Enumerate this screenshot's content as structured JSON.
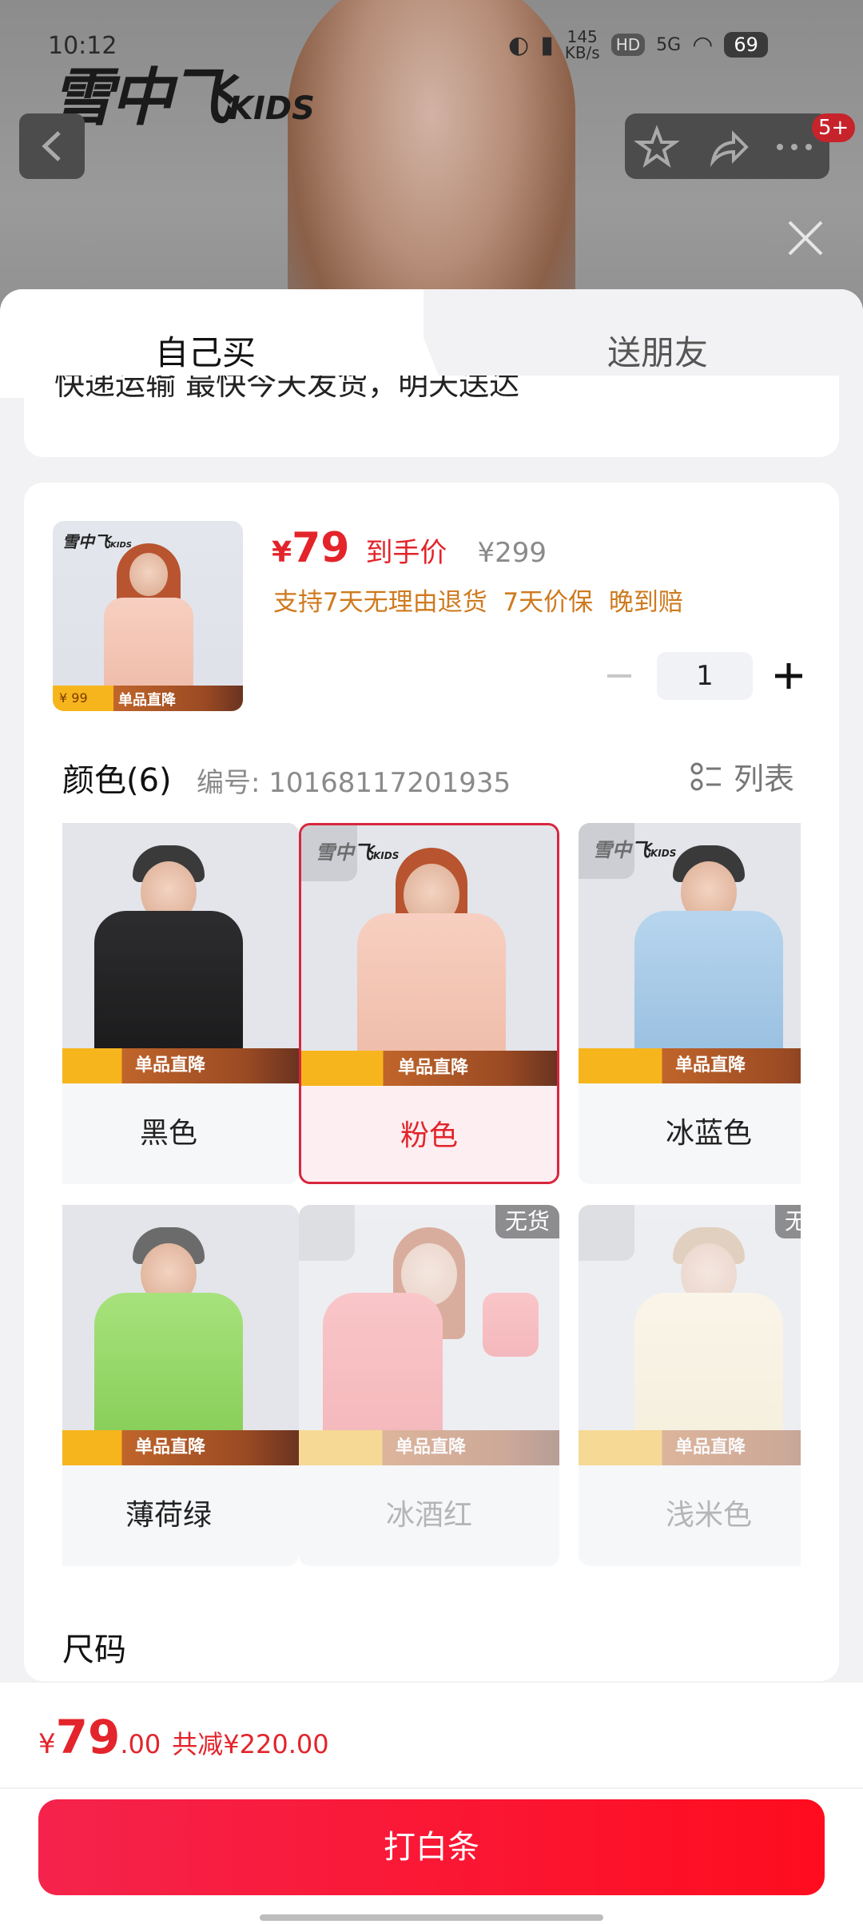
{
  "status_bar": {
    "time": "10:12",
    "net_speed": "145",
    "net_unit": "KB/s",
    "hd": "HD",
    "signal": "5G",
    "battery": "69"
  },
  "hero": {
    "brand": "雪中飞",
    "brand_suffix": "KIDS",
    "badge": "5+"
  },
  "tabs": {
    "self": "自己买",
    "friend": "送朋友"
  },
  "info_card": {
    "text": "快递运输 最快今天发货，明天送达"
  },
  "product": {
    "price_symbol": "¥",
    "price": "79",
    "price_label": "到手价",
    "original_price": "¥299",
    "services": "支持7天无理由退货  7天价保  晚到赔",
    "quantity": "1",
    "thumb_strip_price": "¥ 99",
    "thumb_strip_label": "单品直降"
  },
  "color_section": {
    "title": "颜色(6)",
    "code_label": "编号: 10168117201935",
    "list_label": "列表",
    "options": [
      {
        "label": "黑色",
        "selected": false,
        "soldout": false
      },
      {
        "label": "粉色",
        "selected": true,
        "soldout": false
      },
      {
        "label": "冰蓝色",
        "selected": false,
        "soldout": false
      },
      {
        "label": "薄荷绿",
        "selected": false,
        "soldout": false
      },
      {
        "label": "冰酒红",
        "selected": false,
        "soldout": true
      },
      {
        "label": "浅米色",
        "selected": false,
        "soldout": true
      }
    ],
    "soldout_label": "无货",
    "strip_label": "单品直降",
    "strip_price": "¥ 99"
  },
  "size_section": {
    "title": "尺码"
  },
  "bottom": {
    "price_symbol": "¥",
    "price_int": "79",
    "price_dec": ".00",
    "discount": "共减¥220.00",
    "buy_label": "打白条"
  },
  "colors": {
    "accent": "#e3242b",
    "button": "#ff1a3a"
  }
}
